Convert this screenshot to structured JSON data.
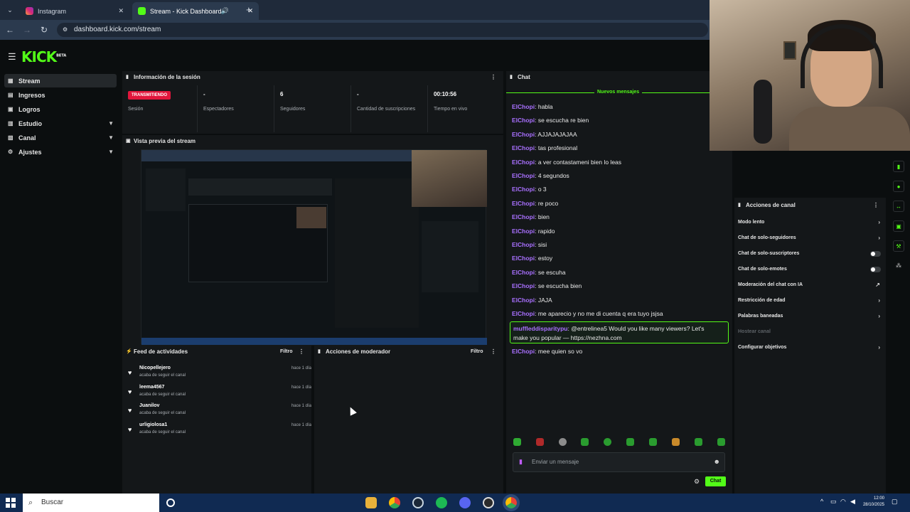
{
  "browser": {
    "tabs": [
      {
        "label": "Instagram",
        "active": false
      },
      {
        "label": "Stream - Kick Dashboard",
        "active": true
      }
    ],
    "url": "dashboard.kick.com/stream"
  },
  "app": {
    "logo": "KICK",
    "logo_badge": "BETA",
    "sidebar": [
      {
        "label": "Stream",
        "icon": "grid-icon",
        "active": true,
        "chevron": false
      },
      {
        "label": "Ingresos",
        "icon": "wallet-icon",
        "active": false,
        "chevron": false
      },
      {
        "label": "Logros",
        "icon": "trophy-icon",
        "active": false,
        "chevron": false
      },
      {
        "label": "Estudio",
        "icon": "studio-icon",
        "active": false,
        "chevron": true
      },
      {
        "label": "Canal",
        "icon": "channel-icon",
        "active": false,
        "chevron": true
      },
      {
        "label": "Ajustes",
        "icon": "gear-icon",
        "active": false,
        "chevron": true
      }
    ],
    "session": {
      "title": "Información de la sesión",
      "status_badge": "TRANSMITIENDO",
      "stats": [
        {
          "value": "",
          "label": "Sesión"
        },
        {
          "value": "-",
          "label": "Espectadores"
        },
        {
          "value": "6",
          "label": "Seguidores"
        },
        {
          "value": "-",
          "label": "Cantidad de suscripciones"
        },
        {
          "value": "00:10:56",
          "label": "Tiempo en vivo"
        }
      ]
    },
    "preview": {
      "title": "Vista previa del stream"
    },
    "feed": {
      "title": "Feed de actividades",
      "filter": "Filtro",
      "items": [
        {
          "name": "Nicopellejero",
          "action": "acaba de seguir el canal",
          "time": "hace 1 día"
        },
        {
          "name": "leema4567",
          "action": "acaba de seguir el canal",
          "time": "hace 1 día"
        },
        {
          "name": "Juanilov",
          "action": "acaba de seguir el canal",
          "time": "hace 1 día"
        },
        {
          "name": "urligiolosa1",
          "action": "acaba de seguir el canal",
          "time": "hace 1 día"
        }
      ]
    },
    "mod_actions": {
      "title": "Acciones de moderador",
      "filter": "Filtro"
    },
    "chat": {
      "title": "Chat",
      "new_messages": "Nuevos mensajes",
      "messages": [
        {
          "user": "ElChopi",
          "text": "habla"
        },
        {
          "user": "ElChopi",
          "text": "se escucha re bien"
        },
        {
          "user": "ElChopi",
          "text": "AJJAJAJAJAA"
        },
        {
          "user": "ElChopi",
          "text": "tas profesional"
        },
        {
          "user": "ElChopi",
          "text": "a ver contastameni bien lo leas"
        },
        {
          "user": "ElChopi",
          "text": "4 segundos"
        },
        {
          "user": "ElChopi",
          "text": "o 3"
        },
        {
          "user": "ElChopi",
          "text": "re poco"
        },
        {
          "user": "ElChopi",
          "text": "bien"
        },
        {
          "user": "ElChopi",
          "text": "rapido"
        },
        {
          "user": "ElChopi",
          "text": "sisi"
        },
        {
          "user": "ElChopi",
          "text": "estoy"
        },
        {
          "user": "ElChopi",
          "text": "se escuha"
        },
        {
          "user": "ElChopi",
          "text": "se escucha bien"
        },
        {
          "user": "ElChopi",
          "text": "JAJA"
        },
        {
          "user": "ElChopi",
          "text": "me aparecio y no me di cuenta q era tuyo jsjsa"
        }
      ],
      "highlight": {
        "user": "muffleddisparitypu",
        "text_line1": "@entrelinea5 Would you like many viewers? Let's",
        "text_line2": "make you popular — https://nezhna.com"
      },
      "last_message": {
        "user": "ElChopi",
        "text": "mee quien so vo"
      },
      "input_placeholder": "Enviar un mensaje",
      "send_button": "Chat"
    },
    "channel_actions": {
      "title": "Acciones de canal",
      "items": [
        {
          "label": "Modo lento",
          "control": "arrow"
        },
        {
          "label": "Chat de solo-seguidores",
          "control": "arrow"
        },
        {
          "label": "Chat de solo-suscriptores",
          "control": "toggle"
        },
        {
          "label": "Chat de solo-emotes",
          "control": "toggle"
        },
        {
          "label": "Moderación del chat con IA",
          "control": "external"
        },
        {
          "label": "Restricción de edad",
          "control": "arrow"
        },
        {
          "label": "Palabras baneadas",
          "control": "arrow"
        },
        {
          "label": "Hostear canal",
          "control": "disabled"
        },
        {
          "label": "Configurar objetivos",
          "control": "arrow"
        }
      ]
    }
  },
  "taskbar": {
    "search": "Buscar",
    "clock_time": "12:00",
    "clock_date": "28/10/2025"
  },
  "colors": {
    "accent": "#53fc18",
    "live": "#e1163c",
    "username": "#a970ff"
  }
}
